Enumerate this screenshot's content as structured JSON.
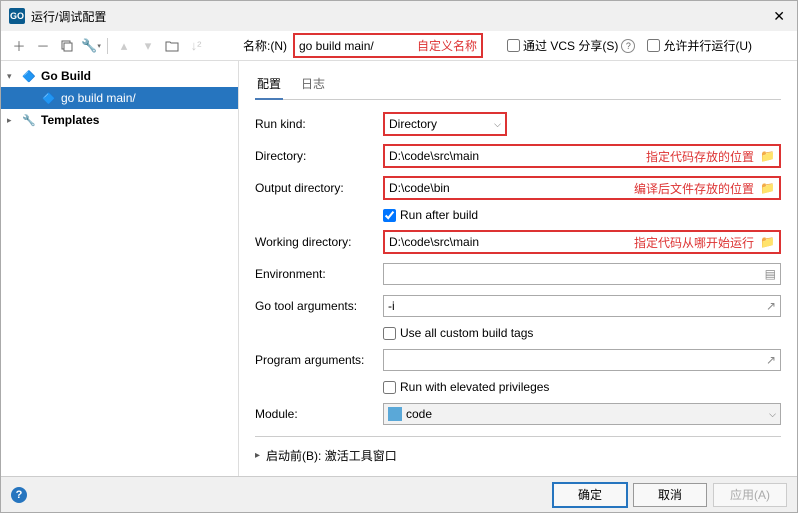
{
  "titlebar": {
    "app_badge": "GO",
    "title": "运行/调试配置"
  },
  "toolbar": {
    "name_label": "名称:(N)",
    "name_value": "go build main/",
    "name_hint": "自定义名称",
    "vcs_share": "通过 VCS 分享(S)",
    "parallel": "允许并行运行(U)"
  },
  "tree": {
    "items": [
      {
        "label": "Go Build",
        "icon": "go",
        "expanded": true,
        "bold": true
      },
      {
        "label": "go build main/",
        "icon": "go",
        "selected": true,
        "child": true
      },
      {
        "label": "Templates",
        "icon": "wrench",
        "expanded": false,
        "bold": true
      }
    ]
  },
  "tabs": {
    "config": "配置",
    "logs": "日志"
  },
  "form": {
    "run_kind_label": "Run kind:",
    "run_kind_value": "Directory",
    "directory_label": "Directory:",
    "directory_value": "D:\\code\\src\\main",
    "directory_hint": "指定代码存放的位置",
    "output_label": "Output directory:",
    "output_value": "D:\\code\\bin",
    "output_hint": "编译后文件存放的位置",
    "run_after_build": "Run after build",
    "working_dir_label": "Working directory:",
    "working_dir_value": "D:\\code\\src\\main",
    "working_dir_hint": "指定代码从哪开始运行",
    "environment_label": "Environment:",
    "environment_value": "",
    "go_tool_args_label": "Go tool arguments:",
    "go_tool_args_value": "-i",
    "use_custom_tags": "Use all custom build tags",
    "program_args_label": "Program arguments:",
    "program_args_value": "",
    "elevated": "Run with elevated privileges",
    "module_label": "Module:",
    "module_value": "code"
  },
  "before_launch": {
    "label": "启动前(B): 激活工具窗口"
  },
  "footer": {
    "ok": "确定",
    "cancel": "取消",
    "apply": "应用(A)"
  }
}
